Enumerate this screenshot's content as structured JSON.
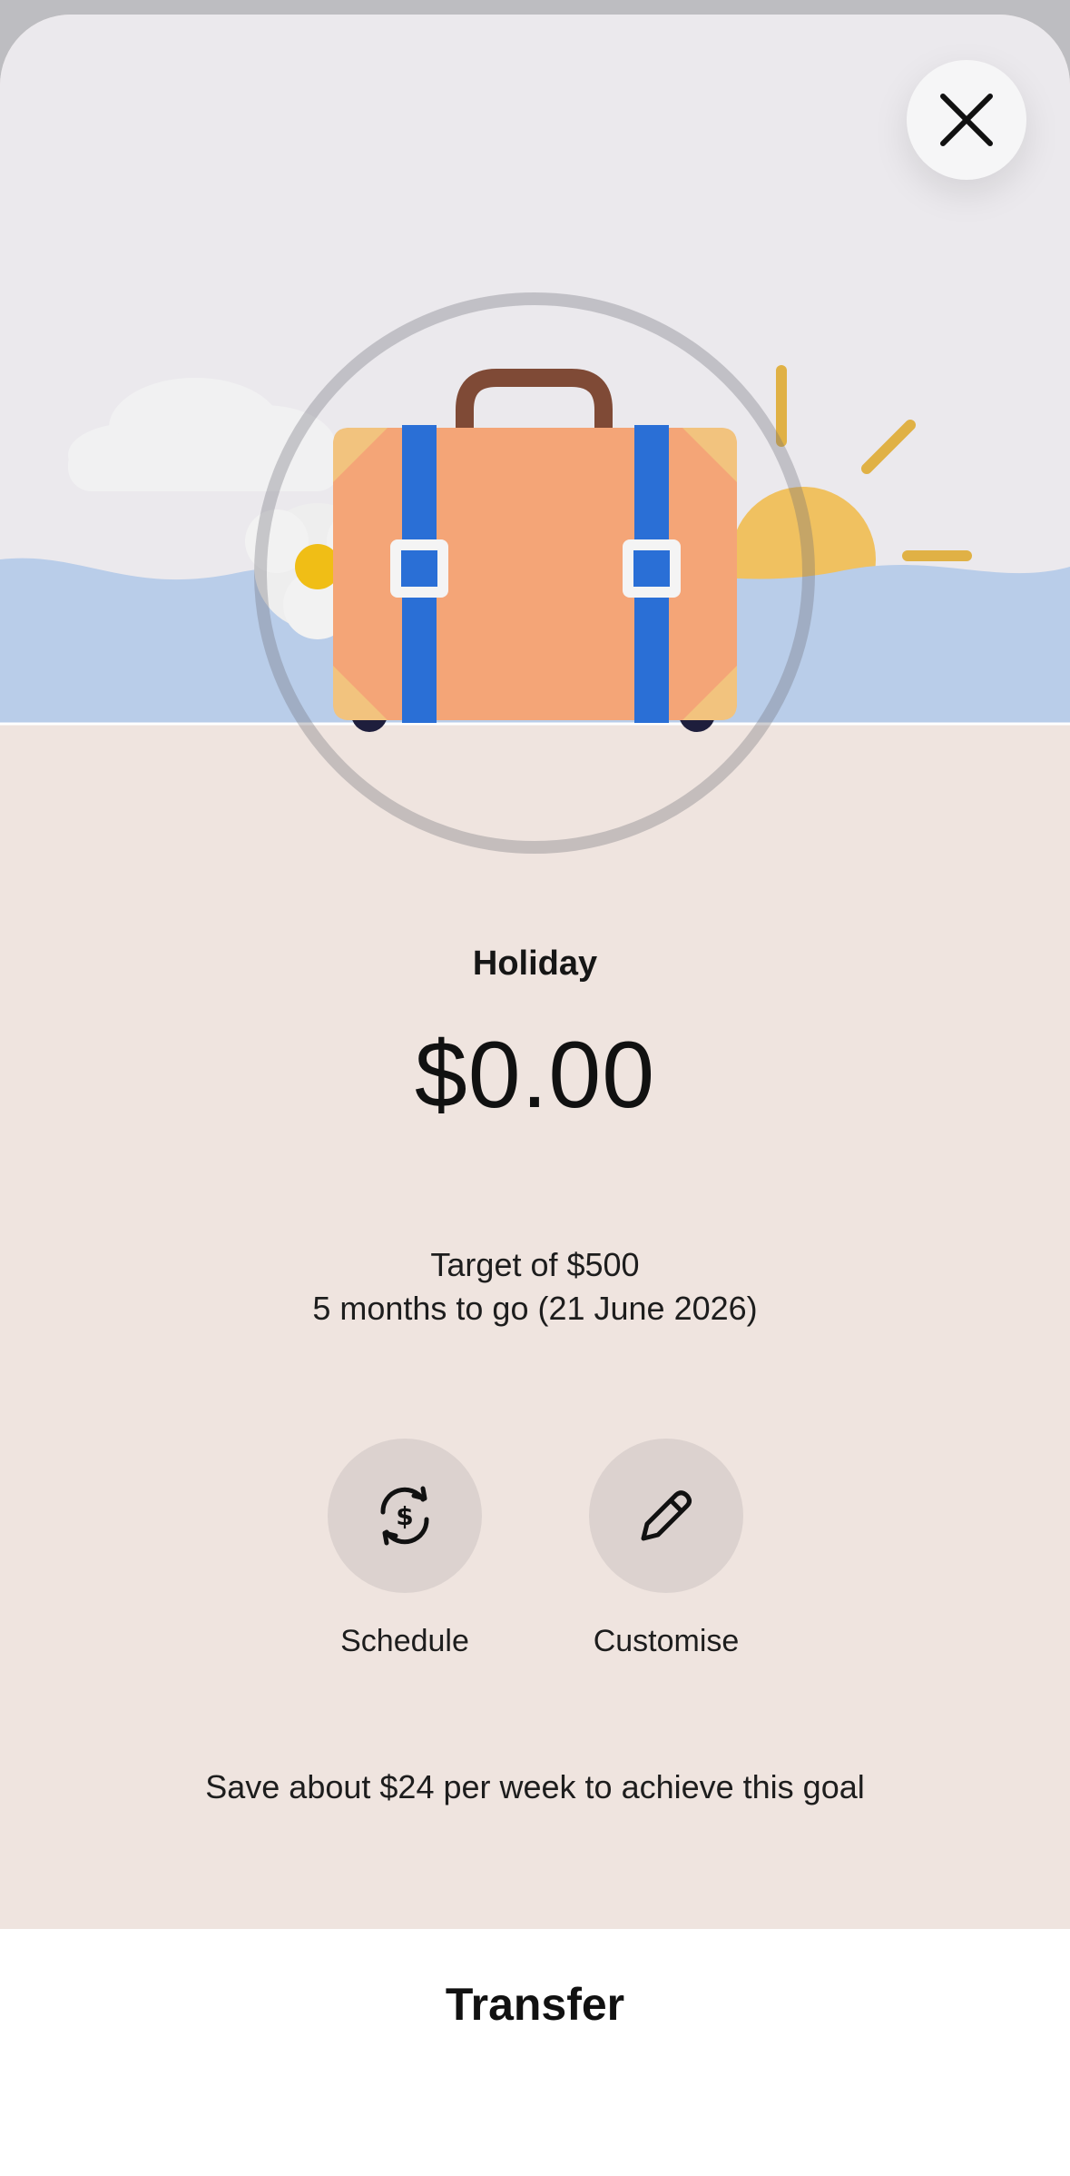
{
  "header": {
    "close_icon": "close-icon"
  },
  "hero": {
    "illustration": "suitcase-holiday-illustration"
  },
  "goal": {
    "name": "Holiday",
    "balance": "$0.00",
    "target": "Target of $500",
    "countdown": "5 months to go (21 June 2026)",
    "progress": 0
  },
  "actions": [
    {
      "label": "Schedule",
      "icon": "recurring-dollar-icon"
    },
    {
      "label": "Customise",
      "icon": "pencil-icon"
    }
  ],
  "tip": "Save about $24 per week to achieve this goal",
  "footer": {
    "transfer_label": "Transfer"
  },
  "colors": {
    "hero_background": "#ebe9ed",
    "water": "#b9cde9",
    "content_background": "#f1e6e1",
    "suitcase": "#f4a577",
    "strap": "#2a6fd6",
    "action_button": "#dcd2cf"
  }
}
